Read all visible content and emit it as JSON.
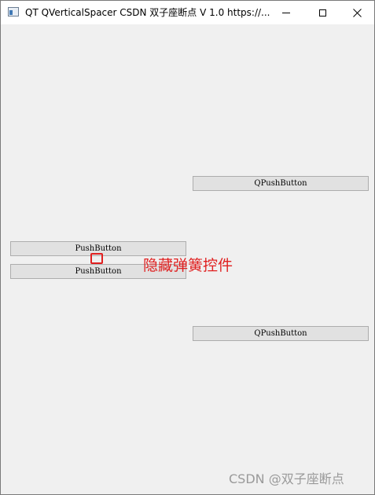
{
  "window": {
    "title": "QT QVerticalSpacer  CSDN 双子座断点 V 1.0 https://..."
  },
  "buttons": {
    "qpush_top": "QPushButton",
    "qpush_bottom": "QPushButton",
    "push_1": "PushButton",
    "push_2": "PushButton"
  },
  "annotation": {
    "text": "隐藏弹簧控件",
    "color": "#e02020"
  },
  "watermark": {
    "text": "CSDN @双子座断点"
  },
  "icons": {
    "app": "qt-window-icon",
    "minimize": "minimize-icon",
    "maximize": "maximize-icon",
    "close": "close-icon"
  }
}
